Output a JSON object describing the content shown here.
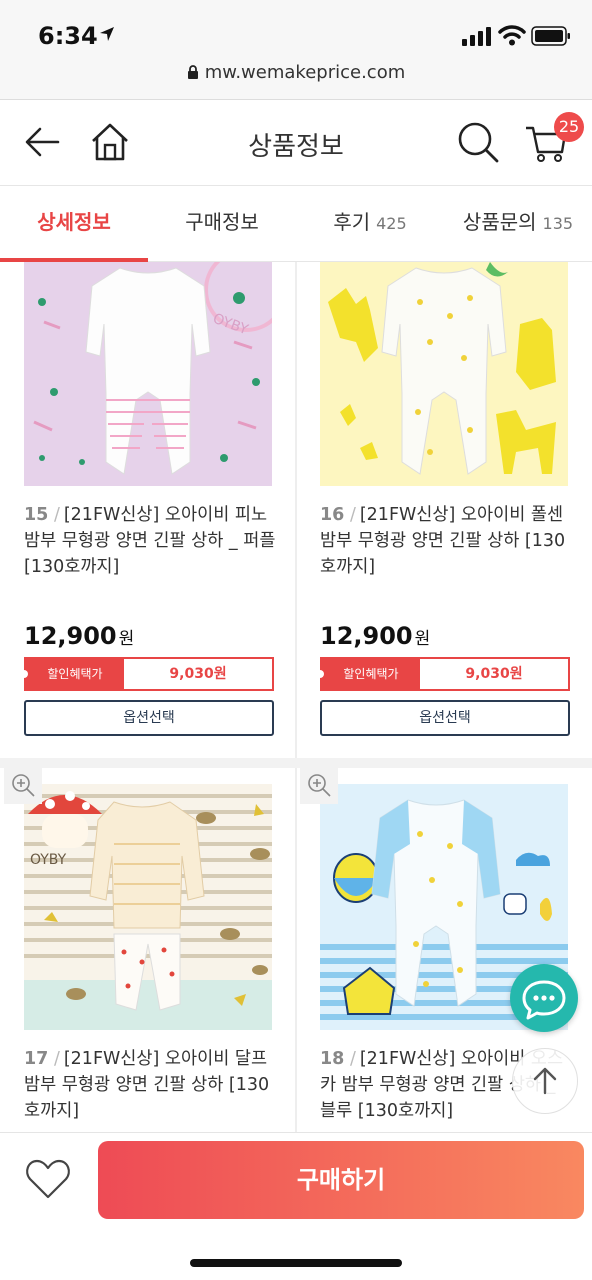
{
  "status": {
    "time": "6:34"
  },
  "browser": {
    "url": "mw.wemakeprice.com"
  },
  "header": {
    "title": "상품정보",
    "cart_count": "25"
  },
  "tabs": [
    {
      "label": "상세정보",
      "count": ""
    },
    {
      "label": "구매정보",
      "count": ""
    },
    {
      "label": "후기",
      "count": "425"
    },
    {
      "label": "상품문의",
      "count": "135"
    }
  ],
  "products": [
    {
      "num": "15",
      "sep": "/",
      "name": "[21FW신상] 오아이비 피노 밤부 무형광 양면 긴팔 상하 _ 퍼플 [130호까지]",
      "price": "12,900",
      "won": "원",
      "discount_label": "할인혜택가",
      "discount_price": "9,030원",
      "option_label": "옵션선택"
    },
    {
      "num": "16",
      "sep": "/",
      "name": "[21FW신상] 오아이비 폴센 밤부 무형광 양면 긴팔 상하 [130호까지]",
      "price": "12,900",
      "won": "원",
      "discount_label": "할인혜택가",
      "discount_price": "9,030원",
      "option_label": "옵션선택"
    },
    {
      "num": "17",
      "sep": "/",
      "name": "[21FW신상] 오아이비 달프 밤부 무형광 양면 긴팔 상하 [130호까지]"
    },
    {
      "num": "18",
      "sep": "/",
      "name": "[21FW신상] 오아이비 오스카 밤부 무형광 양면 긴팔 상하 _ 블루 [130호까지]"
    }
  ],
  "thumb_texts": {
    "brand": "OYBY"
  },
  "bottom": {
    "buy_label": "구매하기"
  },
  "colors": {
    "accent": "#e84545",
    "chat": "#25b8ad",
    "option_border": "#2a3b52"
  },
  "icons": [
    "location-arrow-icon",
    "signal-icon",
    "wifi-icon",
    "battery-icon",
    "lock-icon",
    "back-arrow-icon",
    "home-icon",
    "search-icon",
    "cart-icon",
    "zoom-icon",
    "chat-icon",
    "arrow-up-icon",
    "heart-icon"
  ]
}
